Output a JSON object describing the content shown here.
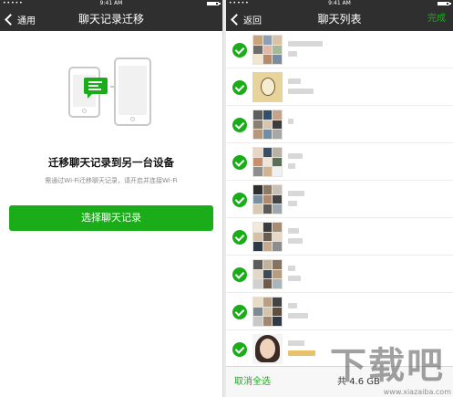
{
  "status_bar": {
    "carrier": "•••••",
    "time": "9:41 AM"
  },
  "left_screen": {
    "nav": {
      "back_label": "通用",
      "title": "聊天记录迁移"
    },
    "heading": "迁移聊天记录到另一台设备",
    "description": "需通过Wi-Fi迁移聊天记录，请开启并连接Wi-Fi",
    "primary_button": "选择聊天记录"
  },
  "right_screen": {
    "nav": {
      "back_label": "返回",
      "title": "聊天列表",
      "done_label": "完成"
    },
    "footer": {
      "deselect_all": "取消全选",
      "total_prefix": "共",
      "total_size": "4.6 GB"
    }
  },
  "watermark": {
    "logo_text": "下载吧",
    "url": "www.xiazaiba.com"
  },
  "colors": {
    "accent_green": "#1aad19",
    "nav_background": "#2f2f2f"
  }
}
